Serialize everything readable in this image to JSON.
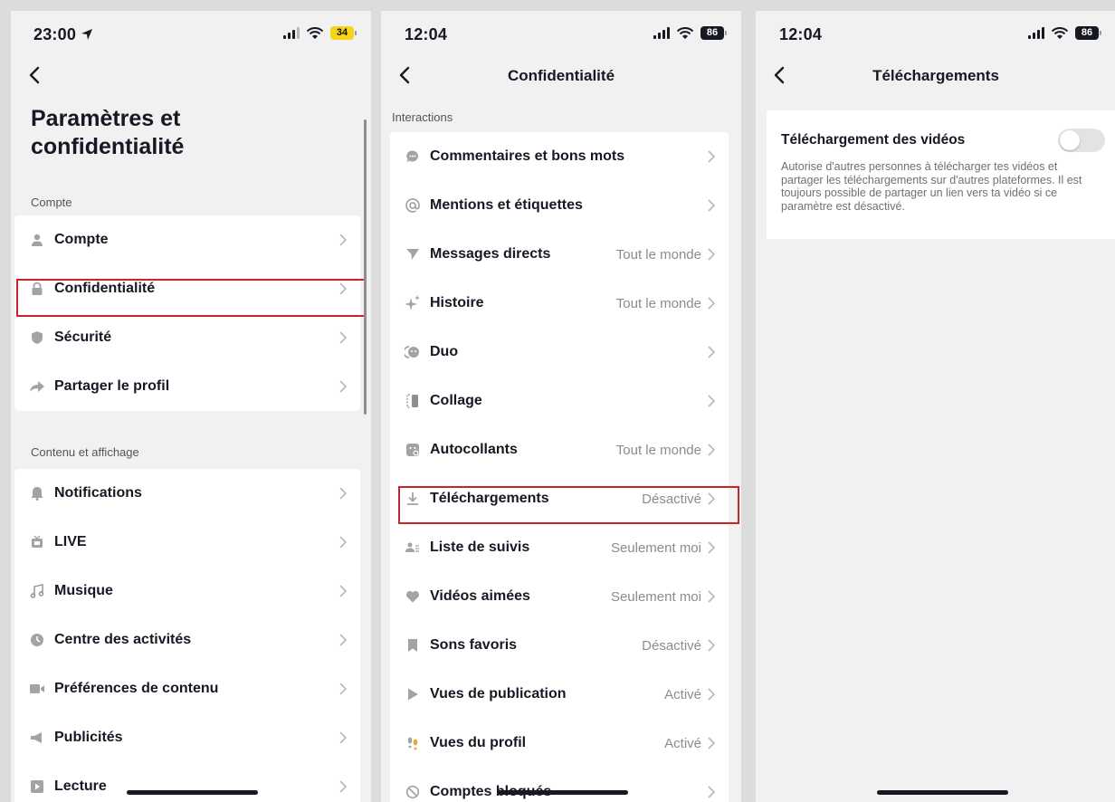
{
  "screen1": {
    "status": {
      "time": "23:00",
      "battery": "34"
    },
    "title": "Paramètres et confidentialité",
    "section_account": "Compte",
    "account_items": [
      {
        "label": "Compte",
        "icon": "person-icon"
      },
      {
        "label": "Confidentialité",
        "icon": "lock-icon"
      },
      {
        "label": "Sécurité",
        "icon": "shield-icon"
      },
      {
        "label": "Partager le profil",
        "icon": "share-icon"
      }
    ],
    "section_content": "Contenu et affichage",
    "content_items": [
      {
        "label": "Notifications",
        "icon": "bell-icon"
      },
      {
        "label": "LIVE",
        "icon": "live-tv-icon"
      },
      {
        "label": "Musique",
        "icon": "music-note-icon"
      },
      {
        "label": "Centre des activités",
        "icon": "clock-icon"
      },
      {
        "label": "Préférences de contenu",
        "icon": "video-camera-icon"
      },
      {
        "label": "Publicités",
        "icon": "megaphone-icon"
      },
      {
        "label": "Lecture",
        "icon": "play-box-icon"
      }
    ]
  },
  "screen2": {
    "status": {
      "time": "12:04",
      "battery": "86"
    },
    "title": "Confidentialité",
    "section": "Interactions",
    "items": [
      {
        "label": "Commentaires et bons mots",
        "value": "",
        "icon": "comment-icon"
      },
      {
        "label": "Mentions et étiquettes",
        "value": "",
        "icon": "at-icon"
      },
      {
        "label": "Messages directs",
        "value": "Tout le monde",
        "icon": "send-icon"
      },
      {
        "label": "Histoire",
        "value": "Tout le monde",
        "icon": "sparkle-icon"
      },
      {
        "label": "Duo",
        "value": "",
        "icon": "duet-icon"
      },
      {
        "label": "Collage",
        "value": "",
        "icon": "stitch-icon"
      },
      {
        "label": "Autocollants",
        "value": "Tout le monde",
        "icon": "sticker-icon"
      },
      {
        "label": "Téléchargements",
        "value": "Désactivé",
        "icon": "download-icon"
      },
      {
        "label": "Liste de suivis",
        "value": "Seulement moi",
        "icon": "people-icon"
      },
      {
        "label": "Vidéos aimées",
        "value": "Seulement moi",
        "icon": "heart-icon"
      },
      {
        "label": "Sons favoris",
        "value": "Désactivé",
        "icon": "bookmark-icon"
      },
      {
        "label": "Vues de publication",
        "value": "Activé",
        "icon": "play-icon"
      },
      {
        "label": "Vues du profil",
        "value": "Activé",
        "icon": "footprints-icon"
      },
      {
        "label": "Comptes bloqués",
        "value": "",
        "icon": "block-icon"
      }
    ]
  },
  "screen3": {
    "status": {
      "time": "12:04",
      "battery": "86"
    },
    "title": "Téléchargements",
    "setting_title": "Téléchargement des vidéos",
    "setting_description": "Autorise d'autres personnes à télécharger tes vidéos et partager les téléchargements sur d'autres plateformes. Il est toujours possible de partager un lien vers ta vidéo si ce paramètre est désactivé.",
    "toggle_on": false
  },
  "colors": {
    "highlight": "#c7252a",
    "battery_low": "#f6d417",
    "toggle_off": "#e3e3e5"
  }
}
